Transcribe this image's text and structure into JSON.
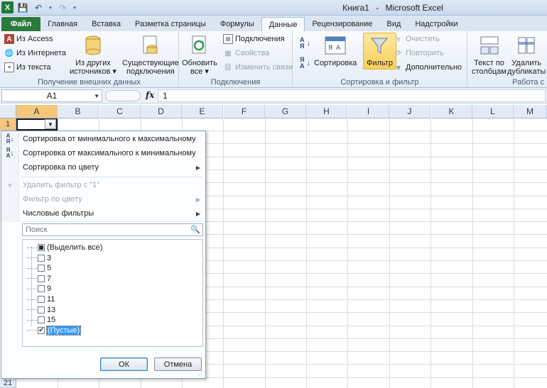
{
  "window": {
    "title_book": "Книга1",
    "title_sep": "-",
    "title_app": "Microsoft Excel",
    "logo": "X"
  },
  "tabs": [
    {
      "label": "Файл"
    },
    {
      "label": "Главная"
    },
    {
      "label": "Вставка"
    },
    {
      "label": "Разметка страницы"
    },
    {
      "label": "Формулы"
    },
    {
      "label": "Данные"
    },
    {
      "label": "Рецензирование"
    },
    {
      "label": "Вид"
    },
    {
      "label": "Надстройки"
    }
  ],
  "ribbon": {
    "external": {
      "from_access": "Из Access",
      "from_web": "Из Интернета",
      "from_text": "Из текста",
      "other_1": "Из других",
      "other_2": "источников ▾",
      "existing_1": "Существующие",
      "existing_2": "подключения",
      "label": "Получение внешних данных"
    },
    "connections": {
      "refresh_1": "Обновить",
      "refresh_2": "все ▾",
      "connections": "Подключения",
      "properties": "Свойства",
      "edit_links": "Изменить связи",
      "label": "Подключения"
    },
    "sortfilter": {
      "sort": "Сортировка",
      "filter": "Фильтр",
      "clear": "Очистить",
      "reapply": "Повторить",
      "advanced": "Дополнительно",
      "label": "Сортировка и фильтр"
    },
    "tools": {
      "text_cols_1": "Текст по",
      "text_cols_2": "столбцам",
      "remove_dup_1": "Удалить",
      "remove_dup_2": "дубликаты",
      "label": "Работа с"
    }
  },
  "formula_bar": {
    "name_box": "A1",
    "fx": "fx",
    "content": "1"
  },
  "columns": [
    "A",
    "B",
    "C",
    "D",
    "E",
    "F",
    "G",
    "H",
    "I",
    "J",
    "K",
    "L",
    "M"
  ],
  "rows": [
    "1",
    "21"
  ],
  "filter_menu": {
    "sort_asc": "Сортировка от минимального к максимальному",
    "sort_desc": "Сортировка от максимального к минимальному",
    "sort_color": "Сортировка по цвету",
    "clear_filter": "Удалить фильтр с \"1\"",
    "filter_color": "Фильтр по цвету",
    "number_filters": "Числовые фильтры",
    "search_placeholder": "Поиск",
    "values": [
      {
        "label": "(Выделить все)",
        "state": "partial"
      },
      {
        "label": "3",
        "state": "unchecked"
      },
      {
        "label": "5",
        "state": "unchecked"
      },
      {
        "label": "7",
        "state": "unchecked"
      },
      {
        "label": "9",
        "state": "unchecked"
      },
      {
        "label": "11",
        "state": "unchecked"
      },
      {
        "label": "13",
        "state": "unchecked"
      },
      {
        "label": "15",
        "state": "unchecked"
      },
      {
        "label": "(Пустые)",
        "state": "checked"
      }
    ],
    "ok": "ОК",
    "cancel": "Отмена"
  }
}
